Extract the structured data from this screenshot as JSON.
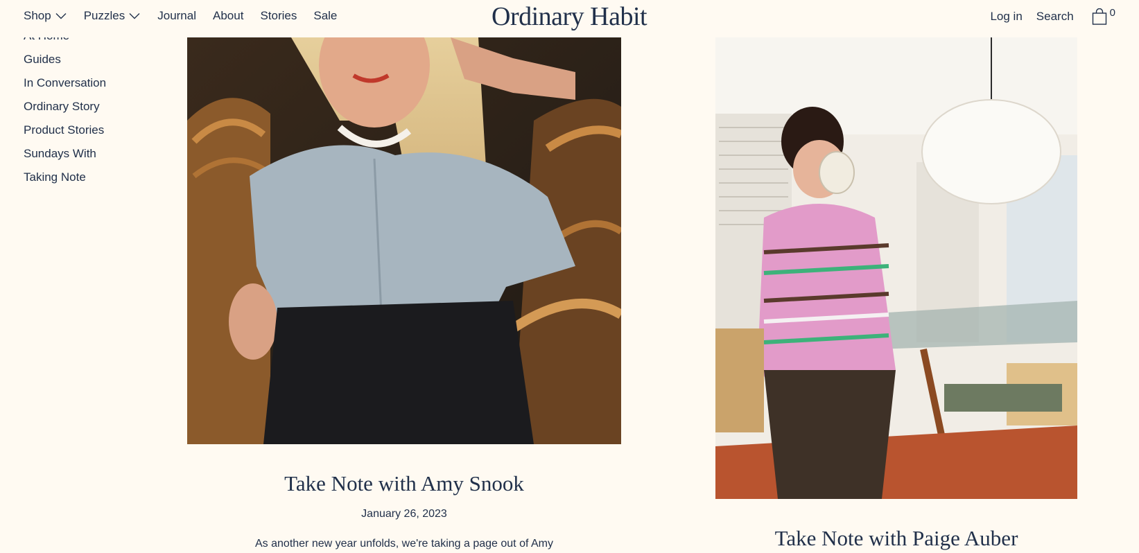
{
  "header": {
    "logo": "Ordinary Habit",
    "nav": {
      "shop": "Shop",
      "puzzles": "Puzzles",
      "journal": "Journal",
      "about": "About",
      "stories": "Stories",
      "sale": "Sale"
    },
    "login": "Log in",
    "search": "Search",
    "cart_count": "0"
  },
  "sidebar": {
    "items": [
      {
        "label": "At Home"
      },
      {
        "label": "Guides"
      },
      {
        "label": "In Conversation"
      },
      {
        "label": "Ordinary Story"
      },
      {
        "label": "Product Stories"
      },
      {
        "label": "Sundays With"
      },
      {
        "label": "Taking Note"
      }
    ]
  },
  "articles": [
    {
      "title": "Take Note with Amy Snook",
      "date": "January 26, 2023",
      "excerpt": "As another new year unfolds, we're taking a page out of Amy"
    },
    {
      "title": "Take Note with Paige Auber"
    }
  ],
  "colors": {
    "background": "#fffaf2",
    "text": "#21304a"
  }
}
